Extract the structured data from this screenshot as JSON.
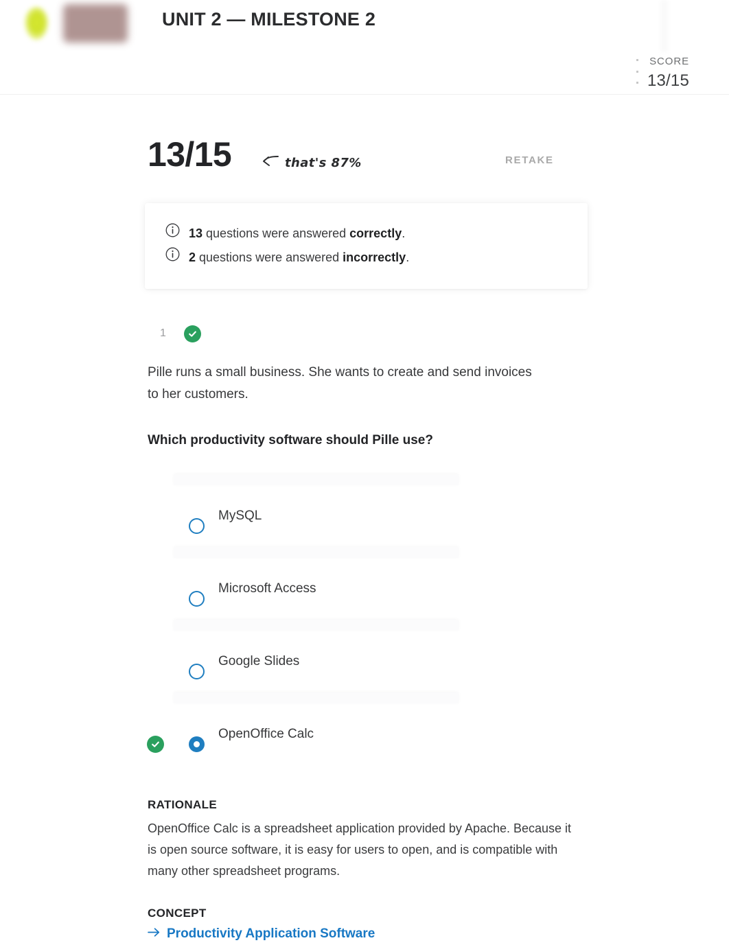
{
  "header": {
    "title": "UNIT 2 — MILESTONE 2",
    "logo_icon": "leaf-logo-icon",
    "redacted_brand": "",
    "score_label": "SCORE",
    "score_value": "13/15",
    "menu_icon": "kebab-menu-icon"
  },
  "result": {
    "score": "13/15",
    "annotation": "that's 87%",
    "annotation_arrow_icon": "curved-arrow-left-icon",
    "retake_label": "RETAKE"
  },
  "summary": {
    "lines": [
      {
        "icon": "info-icon",
        "count": "13",
        "middle": " questions were answered ",
        "emphasis": "correctly",
        "period": "."
      },
      {
        "icon": "info-icon",
        "count": "2",
        "middle": " questions were answered ",
        "emphasis": "incorrectly",
        "period": "."
      }
    ]
  },
  "question": {
    "number": "1",
    "status_icon": "check-circle-icon",
    "stem": "Pille runs a small business. She wants to create and send invoices to her customers.",
    "prompt": "Which productivity software should Pille use?",
    "options": [
      {
        "label": "MySQL",
        "selected": false,
        "correct": false
      },
      {
        "label": "Microsoft Access",
        "selected": false,
        "correct": false
      },
      {
        "label": "Google Slides",
        "selected": false,
        "correct": false
      },
      {
        "label": "OpenOffice Calc",
        "selected": true,
        "correct": true
      }
    ],
    "rationale_heading": "RATIONALE",
    "rationale_text": "OpenOffice Calc is a spreadsheet application provided by Apache. Because it is open source software, it is easy for users to open, and is compatible with many other spreadsheet programs.",
    "concept_heading": "CONCEPT",
    "concept_link": "Productivity Application Software",
    "concept_arrow_icon": "arrow-right-icon"
  },
  "colors": {
    "accent_blue": "#1f7ec0",
    "link_blue": "#1878c4",
    "success_green": "#2aa05e",
    "muted_gray": "#a9a9a9",
    "logo_yellow": "#d6e831"
  }
}
